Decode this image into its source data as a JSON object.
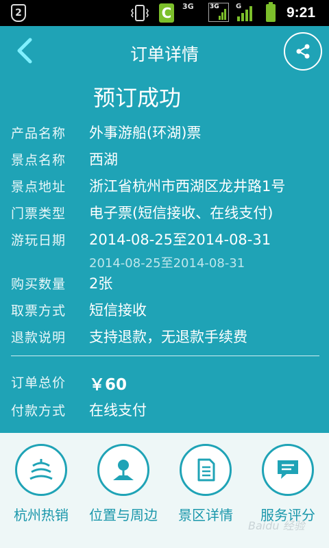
{
  "status_bar": {
    "badge": "2",
    "c_icon": "C",
    "net_a": "3G",
    "net_b": "3G",
    "net_c": "G",
    "time": "9:21"
  },
  "header": {
    "title": "订单详情"
  },
  "success_title": "预订成功",
  "details": [
    {
      "label": "产品名称",
      "value": "外事游船(环湖)票"
    },
    {
      "label": "景点名称",
      "value": "西湖"
    },
    {
      "label": "景点地址",
      "value": "浙江省杭州市西湖区龙井路1号"
    },
    {
      "label": "门票类型",
      "value": "电子票(短信接收、在线支付)"
    },
    {
      "label": "游玩日期",
      "value": "2014-08-25至2014-08-31",
      "sub": "2014-08-25至2014-08-31"
    },
    {
      "label": "购买数量",
      "value": "2张"
    },
    {
      "label": "取票方式",
      "value": "短信接收"
    },
    {
      "label": "退款说明",
      "value": "支持退款，无退款手续费"
    }
  ],
  "price": {
    "label": "订单总价",
    "value": "￥60"
  },
  "payment": {
    "label": "付款方式",
    "value": "在线支付"
  },
  "nav": [
    {
      "label": "杭州热销",
      "icon": "temple-icon"
    },
    {
      "label": "位置与周边",
      "icon": "location-pin-icon"
    },
    {
      "label": "景区详情",
      "icon": "document-icon"
    },
    {
      "label": "服务评分",
      "icon": "chat-bubble-icon"
    }
  ],
  "watermark": "Baidu 经验",
  "colors": {
    "background": "#1fa3b6",
    "nav_background": "#eef7f7",
    "accent": "#1fa3b6"
  }
}
